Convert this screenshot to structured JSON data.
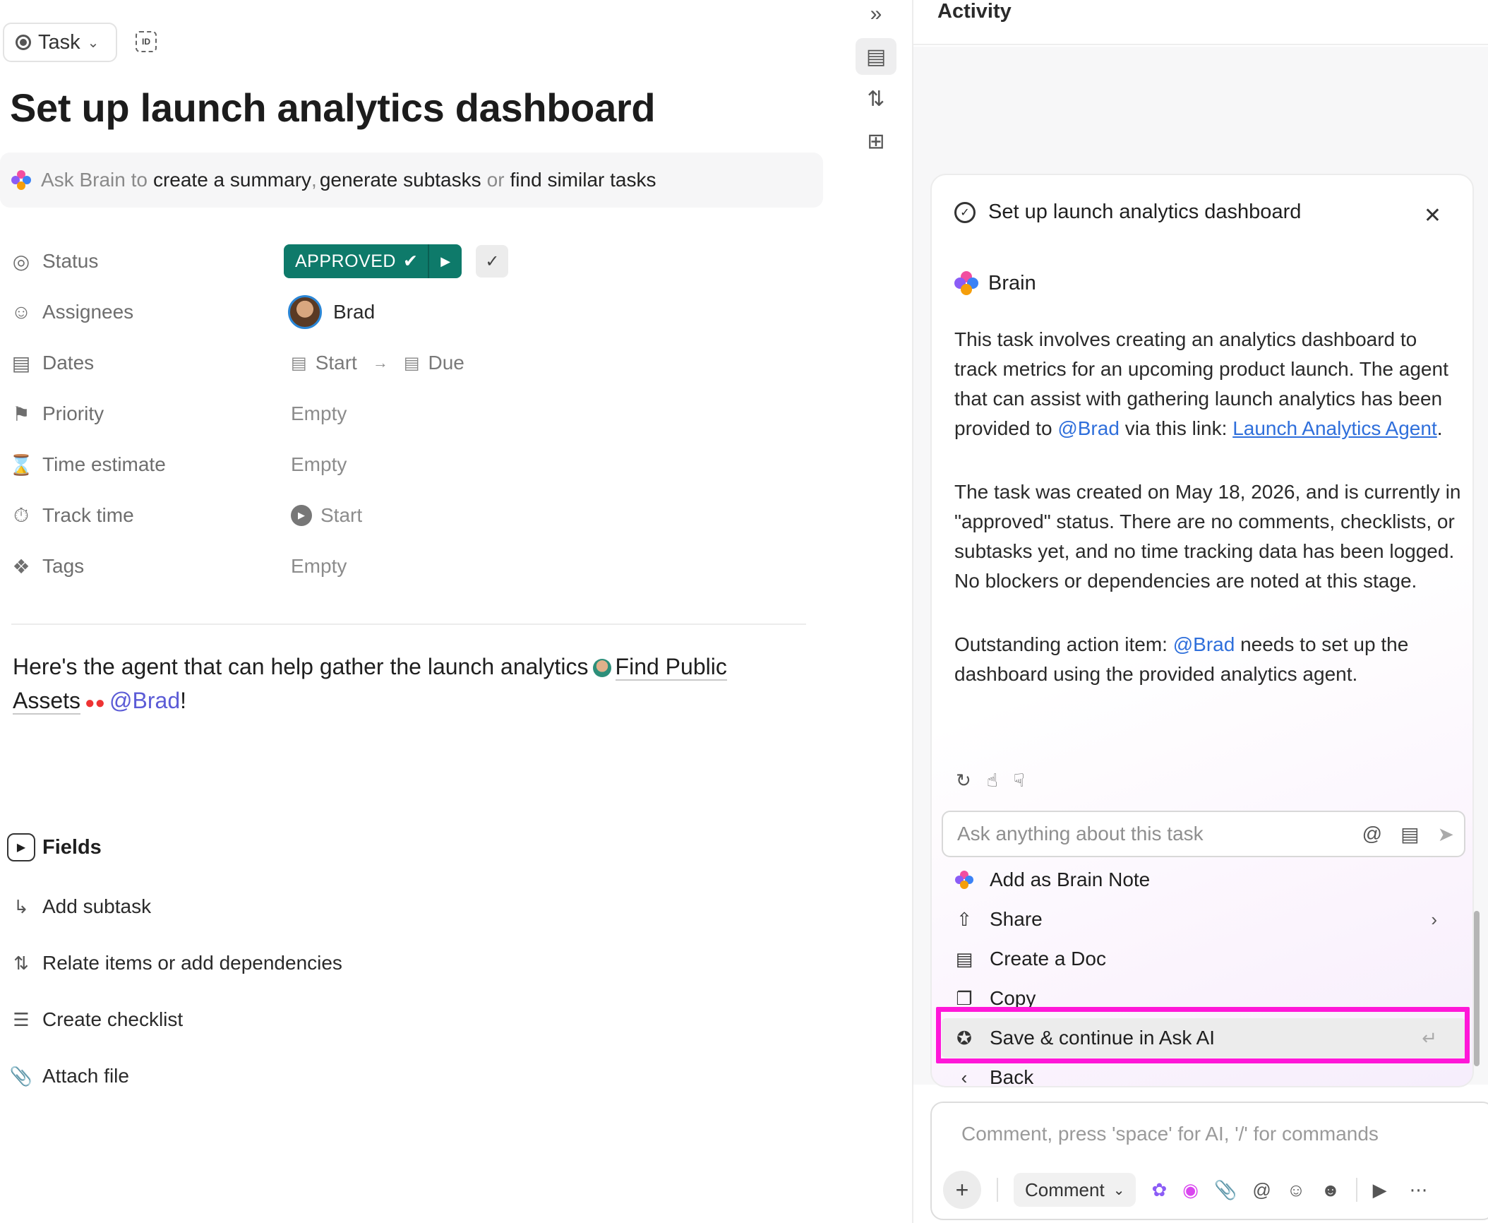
{
  "header": {
    "task_type": "Task",
    "title": "Set up launch analytics dashboard"
  },
  "brain_bar": {
    "prefix": "Ask Brain to",
    "action1": "create a summary",
    "sep1": ",",
    "action2": "generate subtasks",
    "sep2": "or",
    "action3": "find similar tasks"
  },
  "properties": {
    "status_label": "Status",
    "status_value": "APPROVED",
    "assignees_label": "Assignees",
    "assignee": "Brad",
    "dates_label": "Dates",
    "start": "Start",
    "due": "Due",
    "priority_label": "Priority",
    "priority_value": "Empty",
    "time_estimate_label": "Time estimate",
    "time_estimate_value": "Empty",
    "track_time_label": "Track time",
    "track_time_value": "Start",
    "tags_label": "Tags",
    "tags_value": "Empty"
  },
  "description": {
    "text": "Here's the agent that can help gather the launch analytics",
    "agent_name": "Find Public Assets",
    "mention": "@Brad",
    "end": "!"
  },
  "fields_label": "Fields",
  "actions": [
    {
      "label": "Add subtask"
    },
    {
      "label": "Relate items or add dependencies"
    },
    {
      "label": "Create checklist"
    },
    {
      "label": "Attach file"
    }
  ],
  "activity": {
    "title": "Activity"
  },
  "brain_card": {
    "task_title": "Set up launch analytics dashboard",
    "agent": "Brain",
    "p1_a": "This task involves creating an analytics dashboard to track metrics for an upcoming product launch. The agent that can assist with gathering launch analytics has been provided to",
    "p1_mention": "@Brad",
    "p1_b": "via this link:",
    "p1_link": "Launch Analytics Agent",
    "p1_end": ".",
    "p2": "The task was created on May 18, 2026, and is currently in \"approved\" status. There are no comments, checklists, or subtasks yet, and no time tracking data has been logged. No blockers or dependencies are noted at this stage.",
    "p3_a": "Outstanding action item:",
    "p3_mention": "@Brad",
    "p3_b": "needs to set up the dashboard using the provided analytics agent.",
    "ask_placeholder": "Ask anything about this task"
  },
  "menu": [
    {
      "label": "Add as Brain Note",
      "icon": "brain-icon"
    },
    {
      "label": "Share",
      "icon": "share-icon"
    },
    {
      "label": "Create a Doc",
      "icon": "doc-icon"
    },
    {
      "label": "Copy",
      "icon": "copy-icon"
    },
    {
      "label": "Save & continue in Ask AI",
      "icon": "ai-icon"
    },
    {
      "label": "Back",
      "icon": "back-icon"
    }
  ],
  "comment": {
    "placeholder": "Comment, press 'space' for AI, '/' for commands",
    "button": "Comment"
  },
  "colors": {
    "status": "#0e7a6a",
    "highlight": "#ff17d8",
    "mention": "#2f6fdb"
  }
}
